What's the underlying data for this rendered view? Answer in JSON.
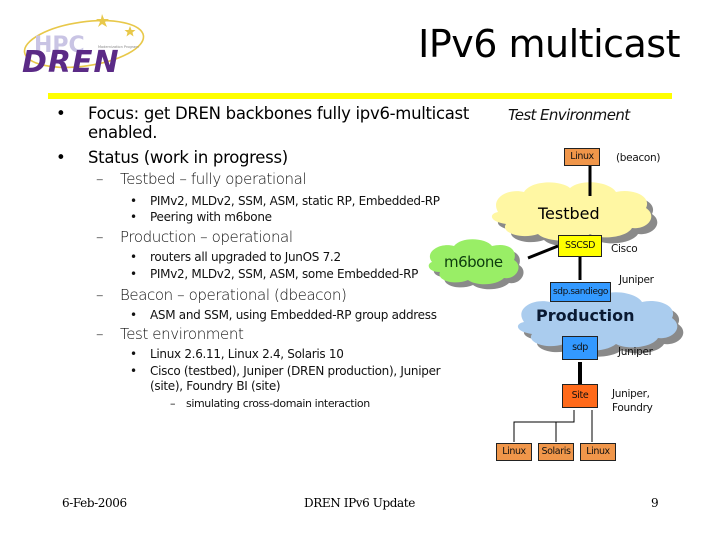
{
  "logo": {
    "top_text": "HPC",
    "main_text": "DREN"
  },
  "title": "IPv6 multicast",
  "colors": {
    "title_rule": "#ffff00",
    "logo_purple": "#5b2a86",
    "logo_lavender": "#c9c4e4",
    "logo_gold": "#e8c84a",
    "testbed_cloud": "#fff7a3",
    "m6bone_cloud": "#99ee66",
    "production_cloud": "#aaccee",
    "linux_node": "#f0964a",
    "sscsd_node": "#ffff00",
    "blue_node": "#3399ff",
    "site_node": "#ff6a1a"
  },
  "bullets": [
    {
      "text": "Focus: get DREN backbones fully ipv6-multicast enabled.",
      "line1": "Focus: get DREN backbones fully ipv6-multicast",
      "line2": "enabled."
    },
    {
      "text": "Status (work in progress)"
    }
  ],
  "status_items": [
    {
      "label": "Testbed – fully operational",
      "sub": [
        "PIMv2, MLDv2, SSM, ASM, static RP, Embedded-RP",
        "Peering with m6bone"
      ]
    },
    {
      "label": "Production – operational",
      "sub": [
        "routers all upgraded to JunOS 7.2",
        "PIMv2, MLDv2, SSM, ASM, some Embedded-RP"
      ]
    },
    {
      "label": "Beacon – operational (dbeacon)",
      "sub": [
        "ASM and SSM, using Embedded-RP group address"
      ]
    },
    {
      "label": "Test environment",
      "sub": [
        "Linux 2.6.11, Linux 2.4, Solaris 10",
        "Cisco (testbed), Juniper (DREN production), Juniper",
        "(site), Foundry BI (site)"
      ],
      "subsub": [
        "simulating cross-domain interaction"
      ]
    }
  ],
  "markers": {
    "bullet": "•",
    "dash": "–"
  },
  "diagram": {
    "title": "Test Environment",
    "clouds": {
      "testbed": "Testbed",
      "m6bone": "m6bone",
      "production": "Production"
    },
    "nodes": {
      "beacon_linux": "Linux",
      "sscsd": "SSCSD",
      "sdp_sandiego": "sdp.sandiego",
      "sdp": "sdp",
      "site": "Site",
      "host1": "Linux",
      "host2": "Solaris",
      "host3": "Linux"
    },
    "labels": {
      "beacon": "(beacon)",
      "sscsd_vendor": "Cisco",
      "sdp_sandiego_vendor": "Juniper",
      "sdp_vendor": "Juniper",
      "site_vendor_line1": "Juniper,",
      "site_vendor_line2": "Foundry"
    }
  },
  "footer": {
    "date": "6-Feb-2006",
    "center": "DREN IPv6 Update",
    "page": "9"
  }
}
